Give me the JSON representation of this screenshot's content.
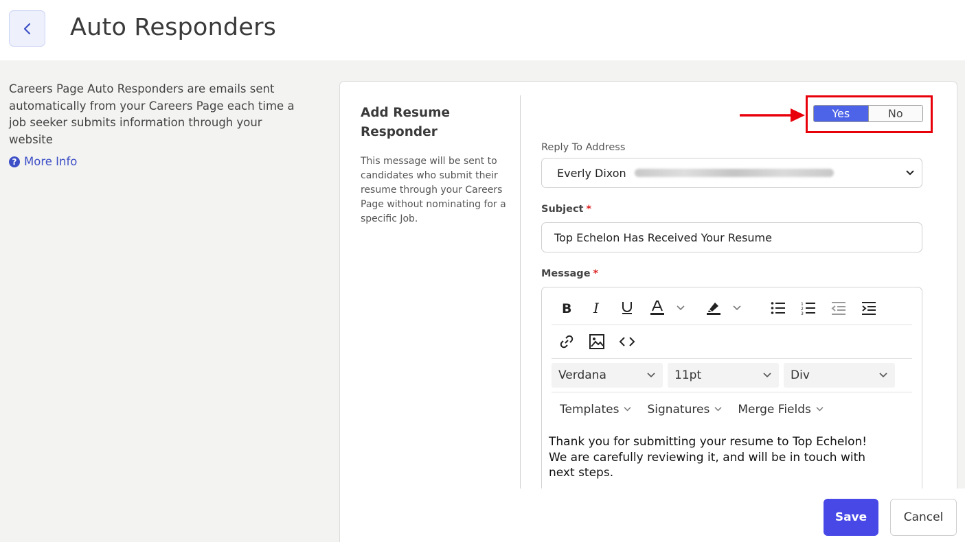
{
  "header": {
    "title": "Auto Responders"
  },
  "sidebar": {
    "description": "Careers Page Auto Responders are emails sent automatically from your Careers Page each time a job seeker submits information through your website",
    "more_info": "More Info"
  },
  "card": {
    "title": "Add Resume Responder",
    "description": "This message will be sent to candidates who submit their resume through your Careers Page without nominating for a specific Job.",
    "toggle": {
      "yes": "Yes",
      "no": "No",
      "selected": "Yes"
    },
    "reply_to": {
      "label": "Reply To Address",
      "value": "Everly Dixon"
    },
    "subject": {
      "label": "Subject",
      "value": "Top Echelon Has Received Your Resume"
    },
    "message": {
      "label": "Message",
      "font": "Verdana",
      "size": "11pt",
      "block": "Div",
      "menus": [
        "Templates",
        "Signatures",
        "Merge Fields"
      ],
      "body_lines": [
        "Thank you for submitting your resume to Top Echelon!",
        "We are carefully reviewing it, and will be in touch with",
        "next steps."
      ]
    }
  },
  "footer": {
    "save": "Save",
    "cancel": "Cancel"
  },
  "colors": {
    "accent": "#4848e6",
    "toggle_active": "#4d63e8",
    "highlight": "#e8000b",
    "required": "#dd2222"
  }
}
